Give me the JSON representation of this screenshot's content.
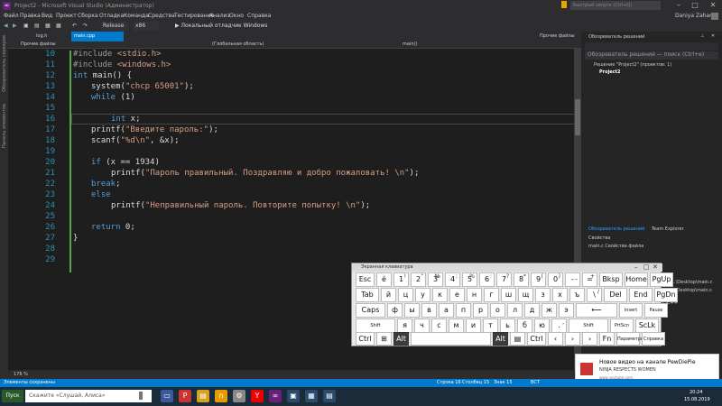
{
  "titlebar": {
    "title": "Project2 - Microsoft Visual Studio (Администратор)",
    "search": "Быстрый запуск (Ctrl+Q)",
    "user": "Daniya Zaharov"
  },
  "menu": [
    "Файл",
    "Правка",
    "Вид",
    "Проект",
    "Сборка",
    "Отладка",
    "Команда",
    "Средства",
    "Тестирование",
    "Анализ",
    "Окно",
    "Справка"
  ],
  "toolbar": {
    "config": "Release",
    "platform": "x86",
    "run": "▶ Локальный отладчик Windows"
  },
  "leftstrip": [
    "Обозреватель серверов",
    "Панель элементов"
  ],
  "doctabs": {
    "tab1": "log.h",
    "tab2": "main.cpp",
    "right": "Прочие файлы"
  },
  "nav": {
    "file": "Прочие файлы",
    "scope": "(Глобальная область)",
    "func": "main()"
  },
  "code": {
    "lines": [
      "10",
      "11",
      "12",
      "13",
      "14",
      "15",
      "16",
      "17",
      "18",
      "19",
      "20",
      "21",
      "22",
      "23",
      "24",
      "25",
      "26",
      "27",
      "28",
      "29"
    ],
    "inc1": "#include",
    "inc1f": "<stdio.h>",
    "inc2": "#include",
    "inc2f": "<windows.h>",
    "l12a": "int",
    "l12b": " main() {",
    "l13a": "system(",
    "l13b": "\"chcp 65001\"",
    "l13c": ");",
    "l14a": "while",
    "l14b": " (1)",
    "l16a": "int",
    "l16b": " x;",
    "l17a": "printf(",
    "l17b": "\"Введите пароль:\"",
    "l17c": ");",
    "l18a": "scanf(",
    "l18b": "\"%d\\n\"",
    "l18c": ", &x);",
    "l20a": "if",
    "l20b": " (x == 1934)",
    "l21a": "printf(",
    "l21b": "\"Пароль правильный. Поздравляю и добро пожаловать! \\n\"",
    "l21c": ");",
    "l22a": "break",
    ";l22b": ";",
    "l23a": "else",
    "l24a": "printf(",
    "l24b": "\"Неправильный пароль. Повторите попытку! \\n\"",
    "l24c": ");",
    "l26a": "return",
    "l26b": " 0;",
    "l27a": "}"
  },
  "zoom": "176 %",
  "rightpanel": {
    "title": "Обозреватель решений",
    "search": "Обозреватель решений — поиск (Ctrl+е)",
    "solution": "Решение \"Project2\" (проектов: 1)",
    "project": "Project2",
    "tab1": "Обозреватель решений",
    "tab2": "Team Explorer",
    "props": "Свойства",
    "propsfile": "main.c  Свойства файла",
    "path1": "\\..\\..\\..\\Desktop\\main.c",
    "path2": "Users\\Desktop\\main.c",
    "cc": "C/C++"
  },
  "statusbar": {
    "left": "Элементы сохранены",
    "line": "Строка 16",
    "col": "Столбец 15",
    "ch": "Знак 15",
    "ins": "ВСТ"
  },
  "taskbar": {
    "start": "Пуск",
    "search": "Скажите «Слушай, Алиса»",
    "time": "20:24",
    "date": "15.08.2019"
  },
  "osk": {
    "title": "Экранная клавиатура",
    "row1": [
      {
        "k": "Esc"
      },
      {
        "k": "ё",
        "s": ""
      },
      {
        "k": "1",
        "s": "!"
      },
      {
        "k": "2",
        "s": "\""
      },
      {
        "k": "3",
        "s": "№"
      },
      {
        "k": "4",
        "s": ";"
      },
      {
        "k": "5",
        "s": "%"
      },
      {
        "k": "6",
        "s": ":"
      },
      {
        "k": "7",
        "s": "?"
      },
      {
        "k": "8",
        "s": "*"
      },
      {
        "k": "9",
        "s": "("
      },
      {
        "k": "0",
        "s": ")"
      },
      {
        "k": "-",
        "s": "_"
      },
      {
        "k": "=",
        "s": "+"
      },
      {
        "k": "Bksp"
      },
      {
        "k": "Home"
      },
      {
        "k": "PgUp"
      }
    ],
    "row2": [
      {
        "k": "Tab"
      },
      {
        "k": "й"
      },
      {
        "k": "ц"
      },
      {
        "k": "у"
      },
      {
        "k": "к"
      },
      {
        "k": "е"
      },
      {
        "k": "н"
      },
      {
        "k": "г"
      },
      {
        "k": "ш"
      },
      {
        "k": "щ"
      },
      {
        "k": "з"
      },
      {
        "k": "х"
      },
      {
        "k": "ъ"
      },
      {
        "k": "\\",
        "s": "/"
      },
      {
        "k": "Del"
      },
      {
        "k": "End"
      },
      {
        "k": "PgDn"
      }
    ],
    "row3": [
      {
        "k": "Caps"
      },
      {
        "k": "ф"
      },
      {
        "k": "ы"
      },
      {
        "k": "в"
      },
      {
        "k": "а"
      },
      {
        "k": "п"
      },
      {
        "k": "р"
      },
      {
        "k": "о"
      },
      {
        "k": "л"
      },
      {
        "k": "д"
      },
      {
        "k": "ж"
      },
      {
        "k": "э"
      },
      {
        "k": "⟵"
      },
      {
        "k": "Insert"
      },
      {
        "k": "Pause"
      }
    ],
    "row4": [
      {
        "k": "Shift"
      },
      {
        "k": "я"
      },
      {
        "k": "ч"
      },
      {
        "k": "с"
      },
      {
        "k": "м"
      },
      {
        "k": "и"
      },
      {
        "k": "т"
      },
      {
        "k": "ь"
      },
      {
        "k": "б"
      },
      {
        "k": "ю"
      },
      {
        "k": ".",
        "s": ","
      },
      {
        "k": "Shift"
      },
      {
        "k": "PrtScn"
      },
      {
        "k": "ScLk"
      }
    ],
    "row5": [
      {
        "k": "Ctrl"
      },
      {
        "k": "⊞"
      },
      {
        "k": "Alt"
      },
      {
        "k": ""
      },
      {
        "k": "Alt"
      },
      {
        "k": "▤"
      },
      {
        "k": "Ctrl"
      },
      {
        "k": "‹"
      },
      {
        "k": "›"
      },
      {
        "k": "›"
      },
      {
        "k": "Fn"
      },
      {
        "k": "Параметры"
      },
      {
        "k": "Справка"
      }
    ]
  },
  "toast": {
    "title": "Новое видео на канале PewDiePie",
    "sub": "NINJA RESPECTS WOMEN",
    "site": "www.youtube.com"
  },
  "colors": {
    "accent": "#007acc",
    "editor_bg": "#1e1e1e",
    "keyword": "#569cd6",
    "string": "#d69d85",
    "linenum": "#2b91af"
  }
}
